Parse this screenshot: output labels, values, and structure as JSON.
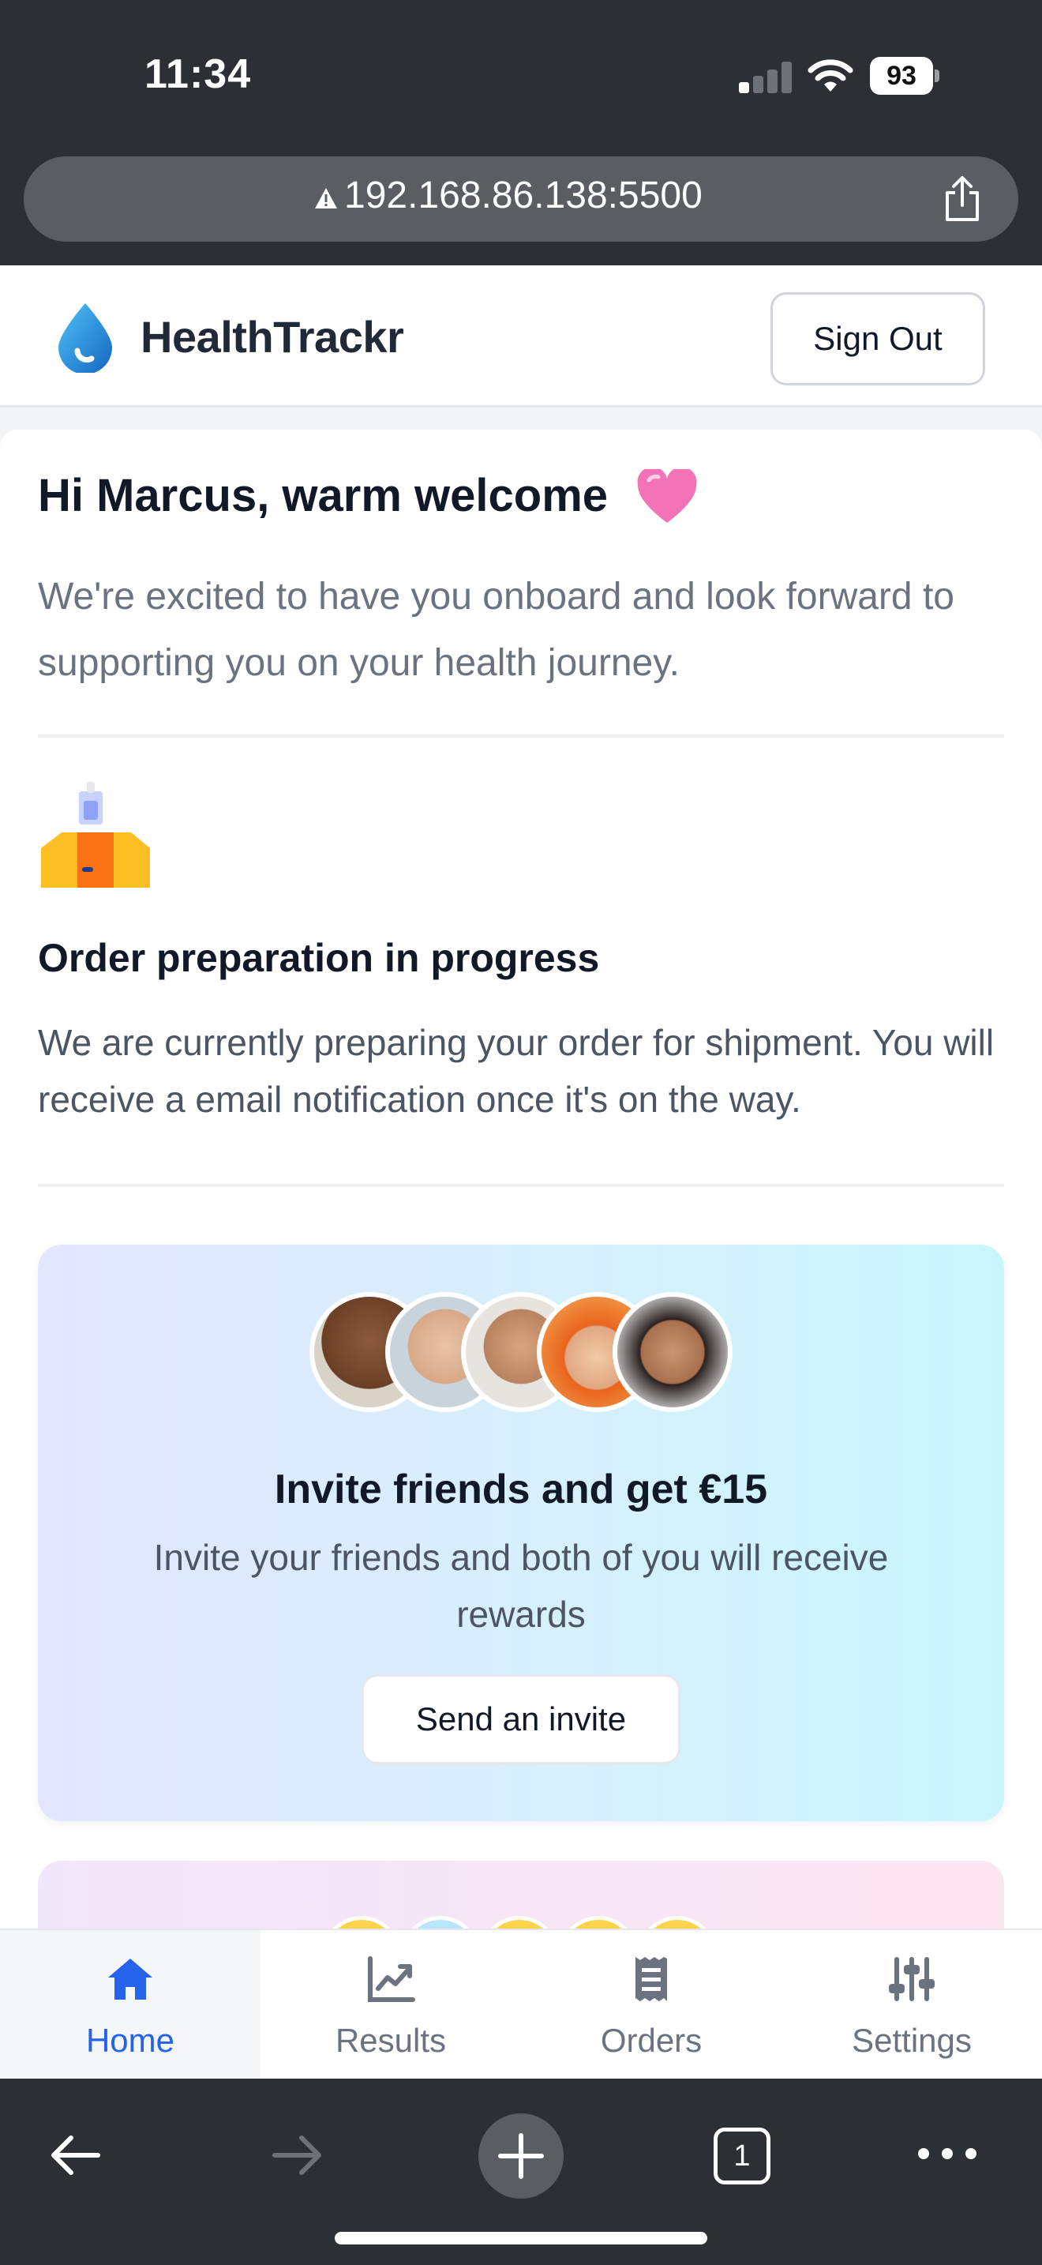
{
  "status_bar": {
    "time": "11:34",
    "battery": "93",
    "signal_bars_on": 1,
    "signal_bars_total": 4
  },
  "browser": {
    "url": "192.168.86.138:5500",
    "tab_count": "1"
  },
  "header": {
    "brand": "HealthTrackr",
    "sign_out_label": "Sign Out"
  },
  "welcome": {
    "greeting": "Hi Marcus, warm welcome",
    "message": "We're excited to have you onboard and look forward to supporting you on your health journey."
  },
  "order": {
    "title": "Order preparation in progress",
    "message": "We are currently preparing your order for shipment. You will receive a email notification once it's on the way."
  },
  "invite": {
    "title": "Invite friends and get €15",
    "message": "Invite your friends and both of you will receive rewards",
    "button_label": "Send an invite"
  },
  "tabs": [
    {
      "label": "Home",
      "icon": "home-icon",
      "active": true
    },
    {
      "label": "Results",
      "icon": "chart-icon",
      "active": false
    },
    {
      "label": "Orders",
      "icon": "receipt-icon",
      "active": false
    },
    {
      "label": "Settings",
      "icon": "sliders-icon",
      "active": false
    }
  ],
  "colors": {
    "accent": "#2563eb",
    "brand_drop": "#1d9bf0",
    "heart": "#f472b6"
  }
}
